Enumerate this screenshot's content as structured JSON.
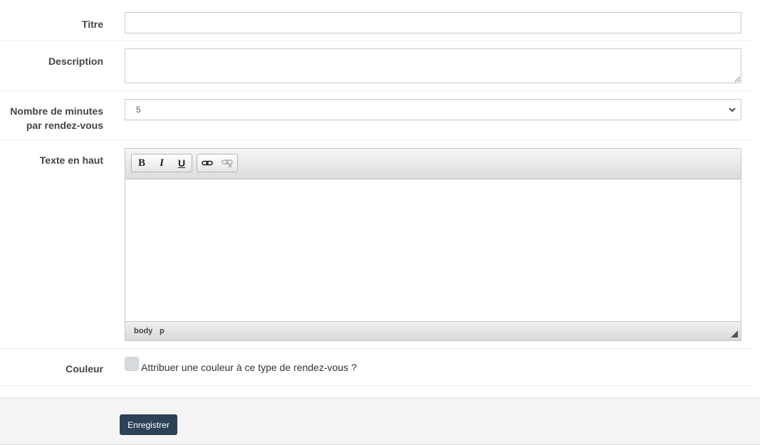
{
  "fields": {
    "titre": {
      "label": "Titre",
      "value": "",
      "placeholder": ""
    },
    "description": {
      "label": "Description",
      "value": "",
      "placeholder": ""
    },
    "minutes": {
      "label_line1": "Nombre de minutes",
      "label_line2": "par rendez-vous",
      "selected": "5"
    },
    "texte_en_haut": {
      "label": "Texte en haut",
      "toolbar": {
        "bold": "B",
        "italic": "I",
        "underline": "U",
        "link_icon": "link-icon",
        "unlink_icon": "unlink-icon"
      },
      "status_path": [
        "body",
        "p"
      ]
    },
    "couleur": {
      "label": "Couleur",
      "checkbox_label": "Attribuer une couleur à ce type de rendez-vous ?",
      "checked": false
    }
  },
  "footer": {
    "save_label": "Enregistrer"
  },
  "colors": {
    "primary_button": "#2d4157",
    "footer_bg": "#f4f4f4"
  }
}
